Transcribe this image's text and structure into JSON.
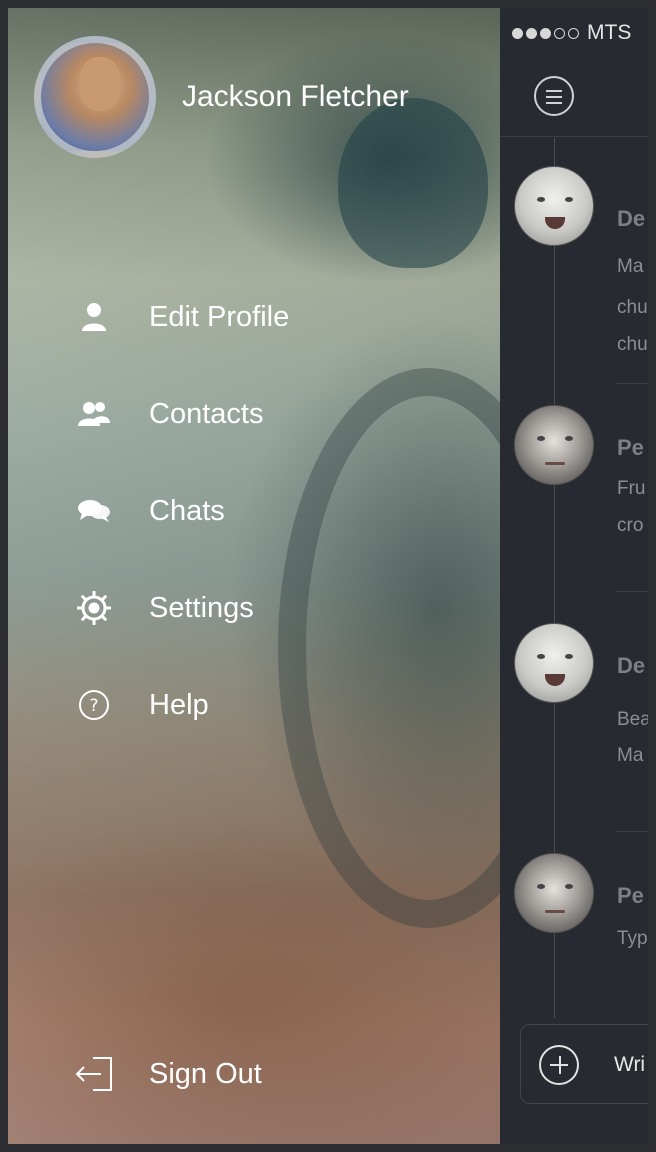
{
  "status_bar": {
    "carrier": "MTS",
    "signal_bars_filled": 3,
    "signal_bars_total": 5
  },
  "profile": {
    "name": "Jackson Fletcher"
  },
  "menu": {
    "items": [
      {
        "label": "Edit Profile",
        "icon": "user-icon"
      },
      {
        "label": "Contacts",
        "icon": "contacts-icon"
      },
      {
        "label": "Chats",
        "icon": "chat-bubbles-icon"
      },
      {
        "label": "Settings",
        "icon": "gear-icon"
      },
      {
        "label": "Help",
        "icon": "question-icon"
      }
    ],
    "sign_out": {
      "label": "Sign Out",
      "icon": "sign-out-icon"
    }
  },
  "chat_feed": {
    "messages": [
      {
        "name": "De",
        "lines": [
          "Ma",
          "chu",
          "chu"
        ]
      },
      {
        "name": "Pe",
        "lines": [
          "Fru",
          "cro"
        ]
      },
      {
        "name": "De",
        "lines": [
          "Bea",
          "Ma"
        ]
      },
      {
        "name": "Pe",
        "lines": [
          "Typ"
        ]
      }
    ],
    "compose_text": "Wri"
  },
  "colors": {
    "drawer_text": "#ffffff",
    "panel_bg": "#272a30"
  }
}
